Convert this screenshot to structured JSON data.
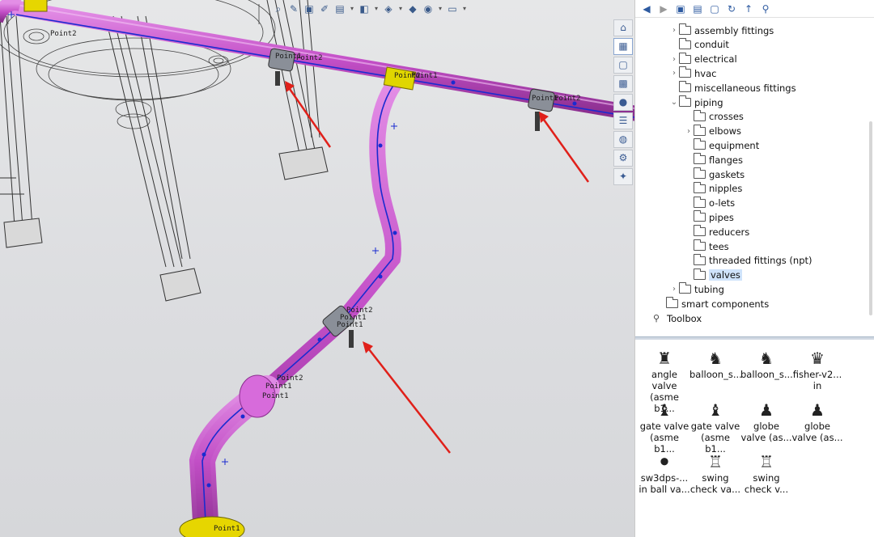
{
  "viewport": {
    "toolbar_icons": [
      "zoom-fit-icon",
      "section-view-icon",
      "view-orientation-icon",
      "display-style-icon",
      "hide-show-icon",
      "edit-appearance-icon",
      "scene-icon",
      "view-settings-icon",
      "monitor-icon"
    ],
    "labels": {
      "point2_a": "Point2",
      "point1_a": "Point1",
      "point2_b": "Point2",
      "point1_b": "Point1",
      "point2_c": "Point2",
      "point1_c": "Point1",
      "point2_d": "Point2",
      "point1_d": "Point1",
      "point1_e": "Point1",
      "point2_f": "Point2",
      "point1_f": "Point1"
    }
  },
  "task_pane": {
    "tabs": [
      "home-icon",
      "design-library-icon",
      "file-explorer-icon",
      "view-palette-icon",
      "appearances-icon",
      "custom-properties-icon",
      "solidworks-forum-icon",
      "toolbox-icon",
      "resources-icon"
    ]
  },
  "library": {
    "toolbar": [
      "back-icon",
      "forward-icon",
      "add-to-library-icon",
      "add-file-location-icon",
      "create-folder-icon",
      "refresh-icon",
      "up-icon",
      "toolbox-settings-icon"
    ],
    "tree": [
      {
        "label": "assembly fittings",
        "level": 1,
        "expanded": false,
        "has_children": true
      },
      {
        "label": "conduit",
        "level": 1,
        "expanded": false,
        "has_children": false
      },
      {
        "label": "electrical",
        "level": 1,
        "expanded": false,
        "has_children": true
      },
      {
        "label": "hvac",
        "level": 1,
        "expanded": false,
        "has_children": true
      },
      {
        "label": "miscellaneous fittings",
        "level": 1,
        "expanded": false,
        "has_children": false
      },
      {
        "label": "piping",
        "level": 1,
        "expanded": true,
        "has_children": true
      },
      {
        "label": "crosses",
        "level": 2,
        "expanded": false,
        "has_children": false
      },
      {
        "label": "elbows",
        "level": 2,
        "expanded": false,
        "has_children": true
      },
      {
        "label": "equipment",
        "level": 2,
        "expanded": false,
        "has_children": false
      },
      {
        "label": "flanges",
        "level": 2,
        "expanded": false,
        "has_children": false
      },
      {
        "label": "gaskets",
        "level": 2,
        "expanded": false,
        "has_children": false
      },
      {
        "label": "nipples",
        "level": 2,
        "expanded": false,
        "has_children": false
      },
      {
        "label": "o-lets",
        "level": 2,
        "expanded": false,
        "has_children": false
      },
      {
        "label": "pipes",
        "level": 2,
        "expanded": false,
        "has_children": false
      },
      {
        "label": "reducers",
        "level": 2,
        "expanded": false,
        "has_children": false
      },
      {
        "label": "tees",
        "level": 2,
        "expanded": false,
        "has_children": false
      },
      {
        "label": "threaded fittings (npt)",
        "level": 2,
        "expanded": false,
        "has_children": false
      },
      {
        "label": "valves",
        "level": 2,
        "expanded": false,
        "has_children": false,
        "selected": true
      },
      {
        "label": "tubing",
        "level": 1,
        "expanded": false,
        "has_children": true
      },
      {
        "label": "smart components",
        "level": 0,
        "expanded": false,
        "has_children": false
      },
      {
        "label": "Toolbox",
        "level": -1,
        "expanded": false,
        "has_children": false,
        "icon": "toolbox-icon"
      }
    ],
    "items": [
      {
        "line1": "angle valve",
        "line2": "(asme b1...",
        "icon": "angle-valve-icon"
      },
      {
        "line1": "balloon_s...",
        "line2": "",
        "icon": "balloon-valve-icon"
      },
      {
        "line1": "balloon_s...",
        "line2": "",
        "icon": "balloon-valve-icon"
      },
      {
        "line1": "fisher-v2...",
        "line2": "in",
        "icon": "fisher-valve-icon"
      },
      {
        "line1": "gate valve",
        "line2": "(asme b1...",
        "icon": "gate-valve-icon"
      },
      {
        "line1": "gate valve",
        "line2": "(asme b1...",
        "icon": "gate-valve-icon"
      },
      {
        "line1": "globe",
        "line2": "valve (as...",
        "icon": "globe-valve-icon"
      },
      {
        "line1": "globe",
        "line2": "valve (as...",
        "icon": "globe-valve-icon"
      },
      {
        "line1": "sw3dps-...",
        "line2": "in ball va...",
        "icon": "ball-valve-icon"
      },
      {
        "line1": "swing",
        "line2": "check va...",
        "icon": "check-valve-icon"
      },
      {
        "line1": "swing",
        "line2": "check v...",
        "icon": "check-valve-icon"
      }
    ]
  },
  "colors": {
    "pipe": "#c34fc7",
    "route_line": "#1a2bd0",
    "arrow": "#e0201a",
    "flange": "#e6d600",
    "selection": "#cfe3fb"
  }
}
